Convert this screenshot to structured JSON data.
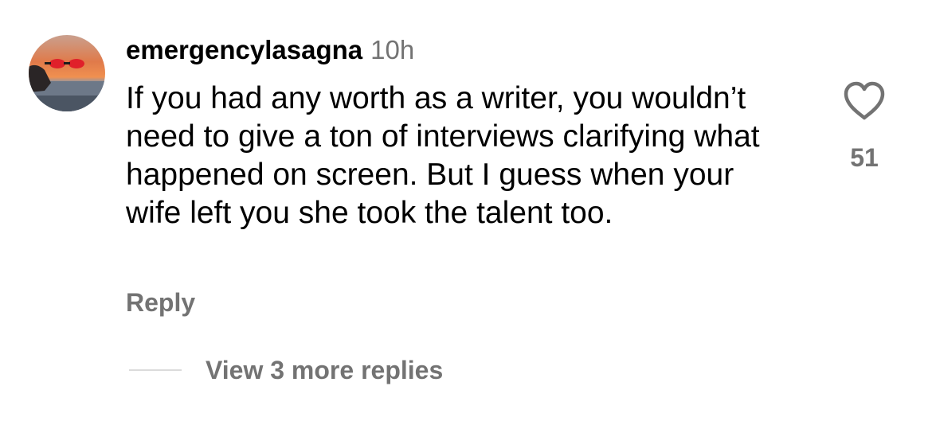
{
  "comment": {
    "username": "emergencylasagna",
    "timestamp": "10h",
    "text": "If you had any worth as a writer, you wouldn’t need to give a ton of interviews clarifying what happened on screen. But I guess when your wife left you she took the talent too.",
    "reply_label": "Reply",
    "view_replies_label": "View 3 more replies",
    "like_count": "51",
    "icons": {
      "like": "heart-outline-icon",
      "avatar": "sunset-photo-avatar"
    }
  },
  "colors": {
    "primary_text": "#000000",
    "secondary_text": "#737373",
    "divider": "#dbdbdb",
    "background": "#ffffff"
  }
}
